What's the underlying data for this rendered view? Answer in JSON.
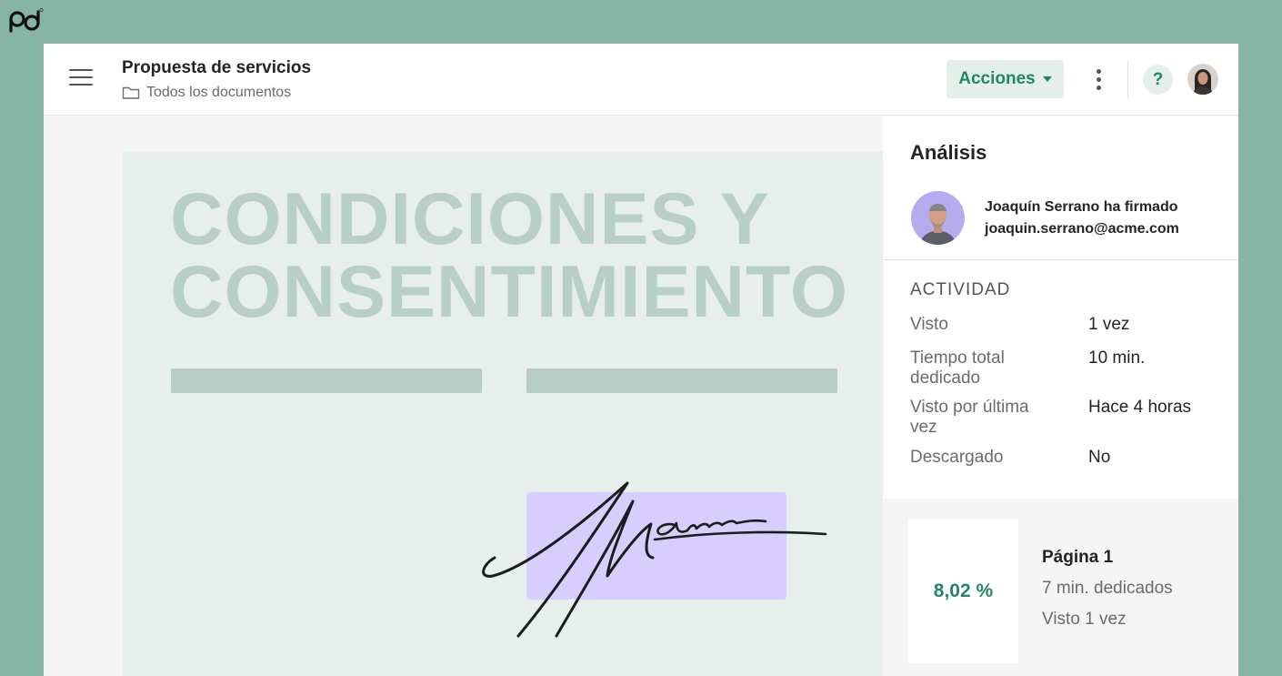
{
  "header": {
    "title": "Propuesta de servicios",
    "breadcrumb": "Todos los documentos",
    "actions_label": "Acciones",
    "help_label": "?"
  },
  "document": {
    "heading_line1": "CONDICIONES Y",
    "heading_line2": "CONSENTIMIENTO"
  },
  "panel": {
    "title": "Análisis",
    "signer": {
      "name_status": "Joaquín Serrano ha firmado",
      "email": "joaquin.serrano@acme.com"
    },
    "activity": {
      "title": "ACTIVIDAD",
      "rows": [
        {
          "label": "Visto",
          "value": "1 vez"
        },
        {
          "label": "Tiempo total dedicado",
          "value": "10 min."
        },
        {
          "label": "Visto por última vez",
          "value": "Hace 4 horas"
        },
        {
          "label": "Descargado",
          "value": "No"
        }
      ]
    },
    "page_stats": {
      "percent": "8,02 %",
      "page": "Página 1",
      "time": "7 min. dedicados",
      "views": "Visto 1 vez"
    }
  },
  "icons": {
    "logo": "pandadoc-logo",
    "menu": "hamburger-menu-icon",
    "folder": "folder-icon",
    "more": "kebab-menu-icon",
    "help": "help-icon"
  },
  "colors": {
    "background": "#86b5a6",
    "accent": "#248567",
    "accent_light": "#e3f0ea",
    "doc_text": "#b8cfc6",
    "signature_field": "#d7cefd"
  }
}
